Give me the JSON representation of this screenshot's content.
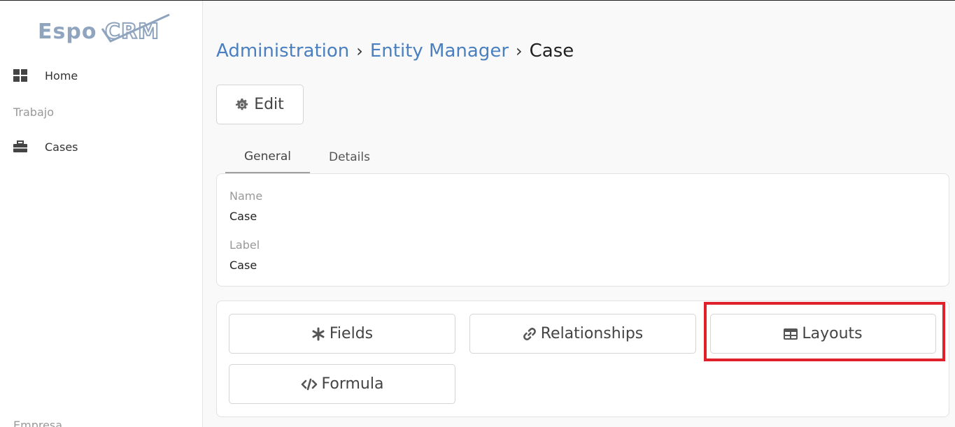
{
  "app": {
    "logo_text": "EspoCRM"
  },
  "sidebar": {
    "home_label": "Home",
    "group_work": "Trabajo",
    "cases_label": "Cases",
    "group_company": "Empresa"
  },
  "breadcrumb": {
    "admin": "Administration",
    "entity_manager": "Entity Manager",
    "current": "Case",
    "separator": "›"
  },
  "toolbar": {
    "edit_label": "Edit"
  },
  "tabs": [
    {
      "label": "General",
      "active": true
    },
    {
      "label": "Details",
      "active": false
    }
  ],
  "details": {
    "name_label": "Name",
    "name_value": "Case",
    "label_label": "Label",
    "label_value": "Case"
  },
  "actions": {
    "fields": "Fields",
    "relationships": "Relationships",
    "layouts": "Layouts",
    "formula": "Formula"
  },
  "colors": {
    "link": "#4a7fc0",
    "highlight": "#e0202a",
    "logo": "#8fa4bf"
  },
  "icons": [
    "dashboard-icon",
    "briefcase-icon",
    "gear-icon",
    "asterisk-icon",
    "link-icon",
    "table-icon",
    "code-icon"
  ]
}
